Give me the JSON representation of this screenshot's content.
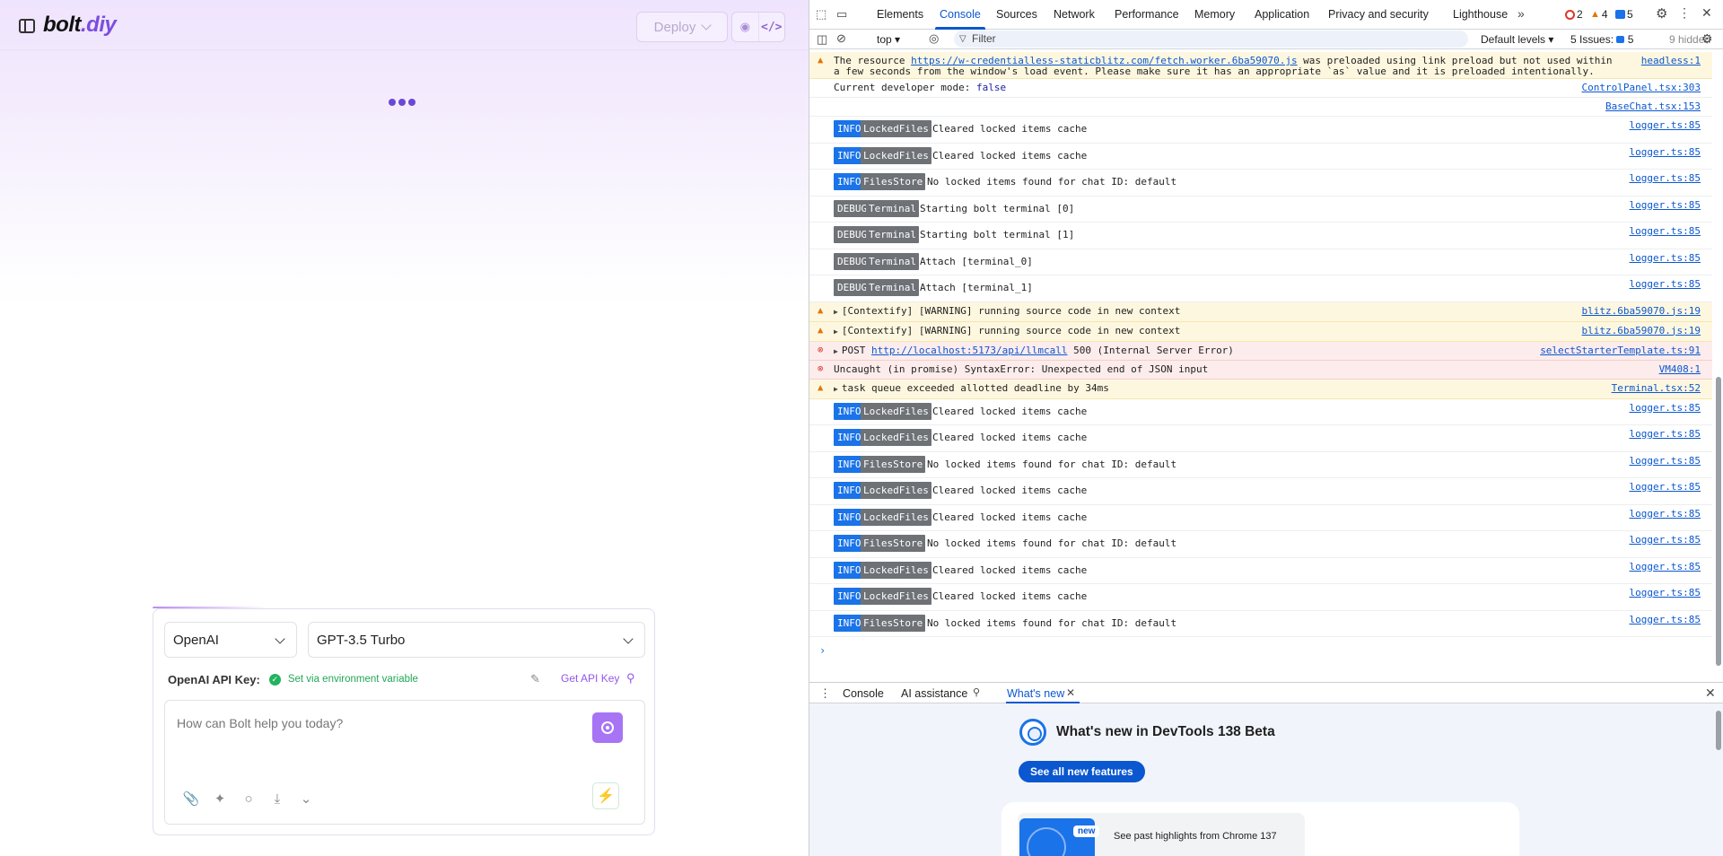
{
  "app": {
    "logo_text_1": "bolt",
    "logo_text_2": ".diy",
    "deploy_label": "Deploy",
    "provider": "OpenAI",
    "model": "GPT-3.5 Turbo",
    "api_key_label": "OpenAI API Key:",
    "api_key_status": "Set via environment variable",
    "get_api_key": "Get API Key",
    "prompt_placeholder": "How can Bolt help you today?"
  },
  "devtools": {
    "tabs": [
      "Elements",
      "Console",
      "Sources",
      "Network",
      "Performance",
      "Memory",
      "Application",
      "Privacy and security",
      "Lighthouse"
    ],
    "active_tab": "Console",
    "errors_count": "2",
    "warnings_count": "4",
    "info_count": "5",
    "context": "top",
    "filter_placeholder": "Filter",
    "levels": "Default levels",
    "issues_label": "5 Issues:",
    "issues_count": "5",
    "hidden": "9 hidden",
    "messages": [
      {
        "type": "warn",
        "text_pre": "The resource ",
        "link": "https://w-credentialless-staticblitz.com/fetch.worker.6ba59070.js",
        "text_post": " was preloaded using link preload but not used within",
        "text_2": "a few seconds from the window's load event. Please make sure it has an appropriate `as` value and it is preloaded intentionally.",
        "src": "headless:1"
      },
      {
        "type": "log",
        "text_pre": "Current developer mode: ",
        "kw": "false",
        "src": "ControlPanel.tsx:303"
      },
      {
        "type": "log",
        "text_pre": "",
        "src": "BaseChat.tsx:153"
      },
      {
        "type": "tag",
        "level": "INFO",
        "cat": "LockedFiles",
        "text": "Cleared locked items cache",
        "src": "logger.ts:85"
      },
      {
        "type": "tag",
        "level": "INFO",
        "cat": "LockedFiles",
        "text": "Cleared locked items cache",
        "src": "logger.ts:85"
      },
      {
        "type": "tag",
        "level": "INFO",
        "cat": "FilesStore",
        "text": "No locked items found for chat ID: default",
        "src": "logger.ts:85"
      },
      {
        "type": "tag",
        "level": "DEBUG",
        "cat": "Terminal",
        "text": "Starting bolt terminal [0]",
        "src": "logger.ts:85"
      },
      {
        "type": "tag",
        "level": "DEBUG",
        "cat": "Terminal",
        "text": "Starting bolt terminal [1]",
        "src": "logger.ts:85"
      },
      {
        "type": "tag",
        "level": "DEBUG",
        "cat": "Terminal",
        "text": "Attach [terminal_0]",
        "src": "logger.ts:85"
      },
      {
        "type": "tag",
        "level": "DEBUG",
        "cat": "Terminal",
        "text": "Attach [terminal_1]",
        "src": "logger.ts:85"
      },
      {
        "type": "warn",
        "tri": true,
        "text_pre": "[Contextify] [WARNING] running source code in new context",
        "src": "blitz.6ba59070.js:19"
      },
      {
        "type": "warn",
        "tri": true,
        "text_pre": "[Contextify] [WARNING] running source code in new context",
        "src": "blitz.6ba59070.js:19"
      },
      {
        "type": "err",
        "tri": true,
        "text_pre": "POST ",
        "link": "http://localhost:5173/api/llmcall",
        "text_post": " 500 (Internal Server Error)",
        "src": "selectStarterTemplate.ts:91"
      },
      {
        "type": "err",
        "text_pre": "Uncaught (in promise) SyntaxError: Unexpected end of JSON input",
        "src": "VM408:1"
      },
      {
        "type": "warn",
        "tri": true,
        "text_pre": "task queue exceeded allotted deadline by 34ms",
        "src": "Terminal.tsx:52"
      },
      {
        "type": "tag",
        "level": "INFO",
        "cat": "LockedFiles",
        "text": "Cleared locked items cache",
        "src": "logger.ts:85"
      },
      {
        "type": "tag",
        "level": "INFO",
        "cat": "LockedFiles",
        "text": "Cleared locked items cache",
        "src": "logger.ts:85"
      },
      {
        "type": "tag",
        "level": "INFO",
        "cat": "FilesStore",
        "text": "No locked items found for chat ID: default",
        "src": "logger.ts:85"
      },
      {
        "type": "tag",
        "level": "INFO",
        "cat": "LockedFiles",
        "text": "Cleared locked items cache",
        "src": "logger.ts:85"
      },
      {
        "type": "tag",
        "level": "INFO",
        "cat": "LockedFiles",
        "text": "Cleared locked items cache",
        "src": "logger.ts:85"
      },
      {
        "type": "tag",
        "level": "INFO",
        "cat": "FilesStore",
        "text": "No locked items found for chat ID: default",
        "src": "logger.ts:85"
      },
      {
        "type": "tag",
        "level": "INFO",
        "cat": "LockedFiles",
        "text": "Cleared locked items cache",
        "src": "logger.ts:85"
      },
      {
        "type": "tag",
        "level": "INFO",
        "cat": "LockedFiles",
        "text": "Cleared locked items cache",
        "src": "logger.ts:85"
      },
      {
        "type": "tag",
        "level": "INFO",
        "cat": "FilesStore",
        "text": "No locked items found for chat ID: default",
        "src": "logger.ts:85"
      }
    ],
    "drawer": {
      "tabs": [
        "Console",
        "AI assistance",
        "What's new"
      ],
      "active_tab": "What's new",
      "title": "What's new in DevTools 138 Beta",
      "features_button": "See all new features",
      "new_badge": "new",
      "card_text": "See past highlights from Chrome 137"
    }
  }
}
